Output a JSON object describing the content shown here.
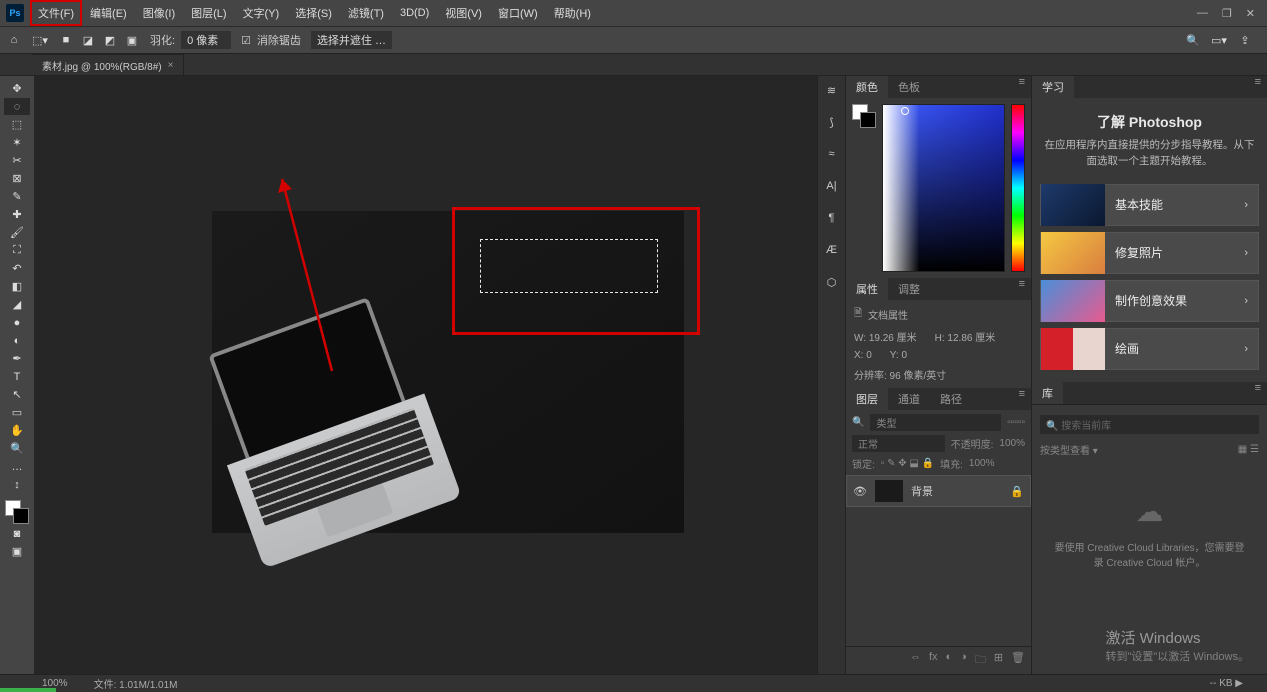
{
  "menu": {
    "file": "文件(F)",
    "edit": "编辑(E)",
    "image": "图像(I)",
    "layer": "图层(L)",
    "type": "文字(Y)",
    "select": "选择(S)",
    "filter": "滤镜(T)",
    "threeD": "3D(D)",
    "view": "视图(V)",
    "window": "窗口(W)",
    "help": "帮助(H)"
  },
  "optbar": {
    "feather_lbl": "羽化:",
    "feather_val": "0 像素",
    "antialias": "消除锯齿",
    "refine": "选择并遮住 …"
  },
  "document": {
    "tab": "素材.jpg @ 100%(RGB/8#)"
  },
  "color_tabs": {
    "color": "颜色",
    "swatch": "色板"
  },
  "props_tabs": {
    "props": "属性",
    "adjust": "调整"
  },
  "props": {
    "doc_props": "文档属性",
    "w_lbl": "W:",
    "w_val": "19.26 厘米",
    "h_lbl": "H:",
    "h_val": "12.86 厘米",
    "x_lbl": "X:",
    "x_val": "0",
    "y_lbl": "Y:",
    "y_val": "0",
    "res": "分辨率: 96 像素/英寸"
  },
  "layers_tabs": {
    "layers": "图层",
    "channels": "通道",
    "paths": "路径"
  },
  "layers": {
    "kind_ph": "类型",
    "normal": "正常",
    "opacity_lbl": "不透明度:",
    "opacity_val": "100%",
    "lock": "锁定:",
    "fill_lbl": "填充:",
    "fill_val": "100%",
    "bg": "背景"
  },
  "learn": {
    "tab": "学习",
    "title": "了解 Photoshop",
    "sub": "在应用程序内直接提供的分步指导教程。从下面选取一个主题开始教程。",
    "c1": "基本技能",
    "c2": "修复照片",
    "c3": "制作创意效果",
    "c4": "绘画"
  },
  "lib": {
    "tab": "库",
    "search_ph": "搜索当前库",
    "group": "按类型查看",
    "msg": "要使用 Creative Cloud Libraries，您需要登录 Creative Cloud 帐户。"
  },
  "activate": {
    "title": "激活 Windows",
    "sub": "转到\"设置\"以激活 Windows。"
  },
  "status": {
    "zoom": "100%",
    "doc": "文件: 1.01M/1.01M",
    "kb": "-- KB ▶"
  }
}
